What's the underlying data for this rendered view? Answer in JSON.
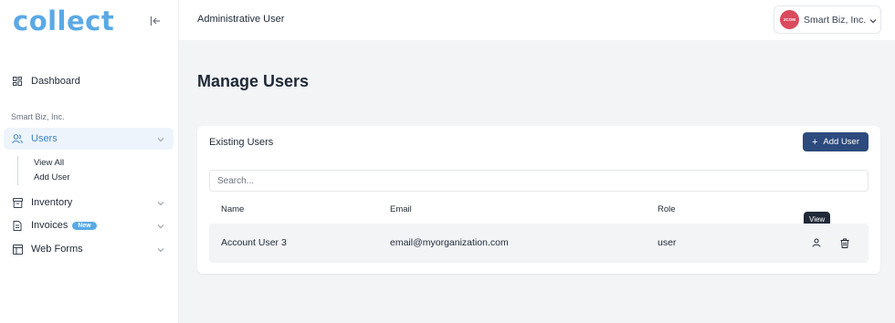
{
  "brand": {
    "logo_text": "collect"
  },
  "sidebar": {
    "dashboard_label": "Dashboard",
    "org_label": "Smart Biz, Inc.",
    "users_label": "Users",
    "users_sub": [
      "View All",
      "Add User"
    ],
    "inventory_label": "Inventory",
    "invoices_label": "Invoices",
    "invoices_badge": "New",
    "webforms_label": "Web Forms"
  },
  "topbar": {
    "title": "Administrative User",
    "org_name": "Smart Biz, Inc.",
    "org_avatar_text": "2COM",
    "org_avatar_color": "#d94a5c"
  },
  "main": {
    "page_title": "Manage Users",
    "card_title": "Existing Users",
    "add_button_label": "Add User",
    "search_placeholder": "Search...",
    "columns": [
      "Name",
      "Email",
      "Role"
    ],
    "rows": [
      {
        "name": "Account User 3",
        "email": "email@myorganization.com",
        "role": "user"
      }
    ],
    "tooltip_text": "View"
  },
  "colors": {
    "accent": "#5aa9e6",
    "primary_button": "#2c4a7d",
    "active_nav": "#3b82c4"
  }
}
